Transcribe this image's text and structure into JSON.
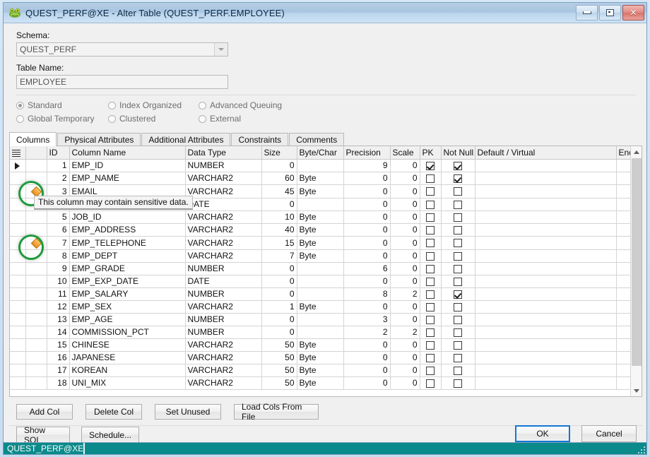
{
  "window": {
    "title": "QUEST_PERF@XE - Alter Table (QUEST_PERF.EMPLOYEE)",
    "app_icon": "frog-icon",
    "minimize_label": "Minimize",
    "maximize_label": "Maximize",
    "close_label": "Close"
  },
  "form": {
    "schema_label": "Schema:",
    "schema_value": "QUEST_PERF",
    "table_label": "Table Name:",
    "table_value": "EMPLOYEE",
    "table_placeholder": "EMPLOYEE"
  },
  "table_types": [
    {
      "label": "Standard",
      "selected": true
    },
    {
      "label": "Index Organized",
      "selected": false
    },
    {
      "label": "Advanced Queuing",
      "selected": false
    },
    {
      "label": "Global Temporary",
      "selected": false
    },
    {
      "label": "Clustered",
      "selected": false
    },
    {
      "label": "External",
      "selected": false
    }
  ],
  "tabs": [
    {
      "label": "Columns",
      "active": true
    },
    {
      "label": "Physical Attributes",
      "active": false
    },
    {
      "label": "Additional Attributes",
      "active": false
    },
    {
      "label": "Constraints",
      "active": false
    },
    {
      "label": "Comments",
      "active": false
    }
  ],
  "grid": {
    "headers": [
      "",
      "",
      "ID",
      "Column Name",
      "Data Type",
      "Size",
      "Byte/Char",
      "Precision",
      "Scale",
      "PK",
      "Not Null",
      "Default / Virtual",
      "Encryption"
    ],
    "rows": [
      {
        "selected": true,
        "flag": false,
        "id": "1",
        "name": "EMP_ID",
        "type": "NUMBER",
        "size": "0",
        "bytechar": "",
        "precision": "9",
        "scale": "0",
        "pk": true,
        "notnull": true,
        "default": "",
        "encryption": ""
      },
      {
        "selected": false,
        "flag": false,
        "id": "2",
        "name": "EMP_NAME",
        "type": "VARCHAR2",
        "size": "60",
        "bytechar": "Byte",
        "precision": "0",
        "scale": "0",
        "pk": false,
        "notnull": true,
        "default": "",
        "encryption": ""
      },
      {
        "selected": false,
        "flag": true,
        "id": "3",
        "name": "EMAIL",
        "type": "VARCHAR2",
        "size": "45",
        "bytechar": "Byte",
        "precision": "0",
        "scale": "0",
        "pk": false,
        "notnull": false,
        "default": "",
        "encryption": ""
      },
      {
        "selected": false,
        "flag": false,
        "id": "4",
        "name": "",
        "type": "DATE",
        "size": "0",
        "bytechar": "",
        "precision": "0",
        "scale": "0",
        "pk": false,
        "notnull": false,
        "default": "",
        "encryption": ""
      },
      {
        "selected": false,
        "flag": false,
        "id": "5",
        "name": "JOB_ID",
        "type": "VARCHAR2",
        "size": "10",
        "bytechar": "Byte",
        "precision": "0",
        "scale": "0",
        "pk": false,
        "notnull": false,
        "default": "",
        "encryption": ""
      },
      {
        "selected": false,
        "flag": false,
        "id": "6",
        "name": "EMP_ADDRESS",
        "type": "VARCHAR2",
        "size": "40",
        "bytechar": "Byte",
        "precision": "0",
        "scale": "0",
        "pk": false,
        "notnull": false,
        "default": "",
        "encryption": ""
      },
      {
        "selected": false,
        "flag": true,
        "id": "7",
        "name": "EMP_TELEPHONE",
        "type": "VARCHAR2",
        "size": "15",
        "bytechar": "Byte",
        "precision": "0",
        "scale": "0",
        "pk": false,
        "notnull": false,
        "default": "",
        "encryption": ""
      },
      {
        "selected": false,
        "flag": false,
        "id": "8",
        "name": "EMP_DEPT",
        "type": "VARCHAR2",
        "size": "7",
        "bytechar": "Byte",
        "precision": "0",
        "scale": "0",
        "pk": false,
        "notnull": false,
        "default": "",
        "encryption": ""
      },
      {
        "selected": false,
        "flag": false,
        "id": "9",
        "name": "EMP_GRADE",
        "type": "NUMBER",
        "size": "0",
        "bytechar": "",
        "precision": "6",
        "scale": "0",
        "pk": false,
        "notnull": false,
        "default": "",
        "encryption": ""
      },
      {
        "selected": false,
        "flag": false,
        "id": "10",
        "name": "EMP_EXP_DATE",
        "type": "DATE",
        "size": "0",
        "bytechar": "",
        "precision": "0",
        "scale": "0",
        "pk": false,
        "notnull": false,
        "default": "",
        "encryption": ""
      },
      {
        "selected": false,
        "flag": false,
        "id": "11",
        "name": "EMP_SALARY",
        "type": "NUMBER",
        "size": "0",
        "bytechar": "",
        "precision": "8",
        "scale": "2",
        "pk": false,
        "notnull": true,
        "default": "",
        "encryption": ""
      },
      {
        "selected": false,
        "flag": false,
        "id": "12",
        "name": "EMP_SEX",
        "type": "VARCHAR2",
        "size": "1",
        "bytechar": "Byte",
        "precision": "0",
        "scale": "0",
        "pk": false,
        "notnull": false,
        "default": "",
        "encryption": ""
      },
      {
        "selected": false,
        "flag": false,
        "id": "13",
        "name": "EMP_AGE",
        "type": "NUMBER",
        "size": "0",
        "bytechar": "",
        "precision": "3",
        "scale": "0",
        "pk": false,
        "notnull": false,
        "default": "",
        "encryption": ""
      },
      {
        "selected": false,
        "flag": false,
        "id": "14",
        "name": "COMMISSION_PCT",
        "type": "NUMBER",
        "size": "0",
        "bytechar": "",
        "precision": "2",
        "scale": "2",
        "pk": false,
        "notnull": false,
        "default": "",
        "encryption": ""
      },
      {
        "selected": false,
        "flag": false,
        "id": "15",
        "name": "CHINESE",
        "type": "VARCHAR2",
        "size": "50",
        "bytechar": "Byte",
        "precision": "0",
        "scale": "0",
        "pk": false,
        "notnull": false,
        "default": "",
        "encryption": ""
      },
      {
        "selected": false,
        "flag": false,
        "id": "16",
        "name": "JAPANESE",
        "type": "VARCHAR2",
        "size": "50",
        "bytechar": "Byte",
        "precision": "0",
        "scale": "0",
        "pk": false,
        "notnull": false,
        "default": "",
        "encryption": ""
      },
      {
        "selected": false,
        "flag": false,
        "id": "17",
        "name": "KOREAN",
        "type": "VARCHAR2",
        "size": "50",
        "bytechar": "Byte",
        "precision": "0",
        "scale": "0",
        "pk": false,
        "notnull": false,
        "default": "",
        "encryption": ""
      },
      {
        "selected": false,
        "flag": false,
        "id": "18",
        "name": "UNI_MIX",
        "type": "VARCHAR2",
        "size": "50",
        "bytechar": "Byte",
        "precision": "0",
        "scale": "0",
        "pk": false,
        "notnull": false,
        "default": "",
        "encryption": ""
      }
    ]
  },
  "tooltip": {
    "text": "This column may contain sensitive data."
  },
  "highlight": {
    "color": "#1e9a3c",
    "flag_icon_color": "#e8901b"
  },
  "column_buttons": [
    {
      "label": "Add Col"
    },
    {
      "label": "Delete Col"
    },
    {
      "label": "Set Unused"
    },
    {
      "label": "Load Cols From File"
    }
  ],
  "footer": {
    "show_sql_label": "Show SQL",
    "schedule_label": "Schedule...",
    "ok_label": "OK",
    "cancel_label": "Cancel"
  },
  "statusbar": {
    "connection": "QUEST_PERF@XE",
    "color": "#0a8a8a"
  }
}
